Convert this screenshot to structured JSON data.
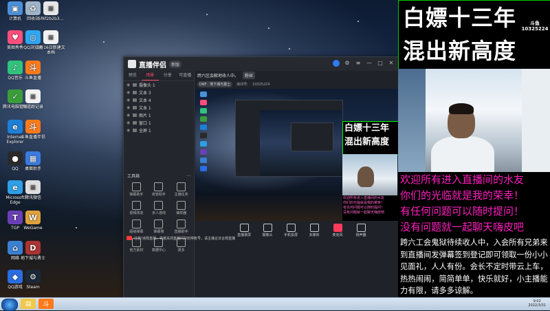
{
  "desktop": {
    "icons": [
      {
        "label": "计算机",
        "icon": "computer-icon",
        "color": "#4a90d9"
      },
      {
        "label": "回收站",
        "icon": "recycle-bin-icon",
        "color": "#9fb4c8"
      },
      {
        "label": "5f6f2b2b3...",
        "icon": "document-icon",
        "color": "#e6e6e6"
      },
      {
        "label": "美图秀秀",
        "icon": "meitu-icon",
        "color": "#ff4f7b"
      },
      {
        "label": "QQ浏览器",
        "icon": "qq-browser-icon",
        "color": "#2fa7f2"
      },
      {
        "label": "3月16日新建文本档",
        "icon": "text-file-icon",
        "color": "#f2f2f2"
      },
      {
        "label": "QQ音乐",
        "icon": "qq-music-icon",
        "color": "#31c27c"
      },
      {
        "label": "斗鱼直播",
        "icon": "douyu-icon",
        "color": "#ff7a1a"
      },
      {
        "label": "腾讯电脑管家",
        "icon": "pc-manager-icon",
        "color": "#3a9d3a"
      },
      {
        "label": "频道跑记录",
        "icon": "text-file-icon",
        "color": "#f2f2f2"
      },
      {
        "label": "Internet Explorer",
        "icon": "ie-icon",
        "color": "#1e7fd6"
      },
      {
        "label": "斗鱼直播伴侣",
        "icon": "douyu-companion-icon",
        "color": "#ff7a1a"
      },
      {
        "label": "QQ",
        "icon": "qq-icon",
        "color": "#2a2a2a"
      },
      {
        "label": "桌面助手",
        "icon": "desktop-assistant-icon",
        "color": "#3a7be0"
      },
      {
        "label": "Microsoft Edge",
        "icon": "edge-icon",
        "color": "#2e9ee6"
      },
      {
        "label": "腾讯微信",
        "icon": "document-icon",
        "color": "#dddddd"
      },
      {
        "label": "TGP",
        "icon": "tgp-icon",
        "color": "#6a3fb5"
      },
      {
        "label": "WeGame",
        "icon": "wegame-icon",
        "color": "#e0a23a"
      },
      {
        "label": "网络",
        "icon": "network-icon",
        "color": "#3b7fd1"
      },
      {
        "label": "地下城与勇士",
        "icon": "dnf-icon",
        "color": "#a33"
      },
      {
        "label": "QQ游戏",
        "icon": "qq-game-icon",
        "color": "#2a6de0"
      },
      {
        "label": "Steam",
        "icon": "steam-icon",
        "color": "#1b2838"
      }
    ]
  },
  "taskbar": {
    "time": "9:02",
    "date": "2022/3/31",
    "items": [
      {
        "icon": "explorer-icon",
        "color": "#f1c84b"
      },
      {
        "icon": "douyu-companion-icon",
        "color": "#ff7a1a"
      }
    ]
  },
  "app": {
    "name": "直播伴侣",
    "tag": "新版",
    "tabs": [
      "预览",
      "场景",
      "分享",
      "可直播"
    ],
    "active_tab": 1,
    "sources": [
      {
        "label": "摄像头 1"
      },
      {
        "label": "文本 3"
      },
      {
        "label": "文本 4"
      },
      {
        "label": "文本 1"
      },
      {
        "label": "图片 1"
      },
      {
        "label": "窗口 1"
      },
      {
        "label": "全屏 1"
      }
    ],
    "tools_header": "工具箱",
    "tools": [
      "弹幕助手",
      "房管助手",
      "主播任务",
      "视频改造",
      "多人连线",
      "抽奖器",
      "超级弹幕",
      "弹幕墙",
      "直播助手",
      "官方素材",
      "数据中心",
      "更多"
    ],
    "notice": "注意!违规直播，将被关闭直播间并封停账号，请主播合法合规直播",
    "topbar": {
      "room_title": "跨六区会献地收人中。",
      "badge": "粉丝",
      "game": "DNF · 地下城与勇士",
      "room_label": "房间号:",
      "room_id": "10325224"
    },
    "bottom_tools": [
      "直播录屏",
      "摄像头",
      "手机投屏",
      "多媒体",
      "麦克风",
      "扬声器"
    ]
  },
  "overlay": {
    "title_line1": "白嫖十三年",
    "title_line2": "混出新高度",
    "watermark_label": "斗鱼",
    "watermark_id": "10325224",
    "welcome_lines": [
      "欢迎所有进入直播间的水友",
      "你们的光临就是我的荣幸！",
      "有任何问题可以随时提问！",
      "没有问题就一起聊天嗨皮吧"
    ],
    "notice_text": "跨六工会鬼狱待续收人中，入会所有兄弟来到直播间发弹幕签到登记即可领取一份小小见面礼，人人有份。会长不定时带云上车，热热闹闹，简简单单，快乐就好，小主播能力有限，请多多谅解。",
    "colors": {
      "welcome": "#ff1fbf",
      "border": "#00cc00",
      "background": "#000000"
    }
  }
}
